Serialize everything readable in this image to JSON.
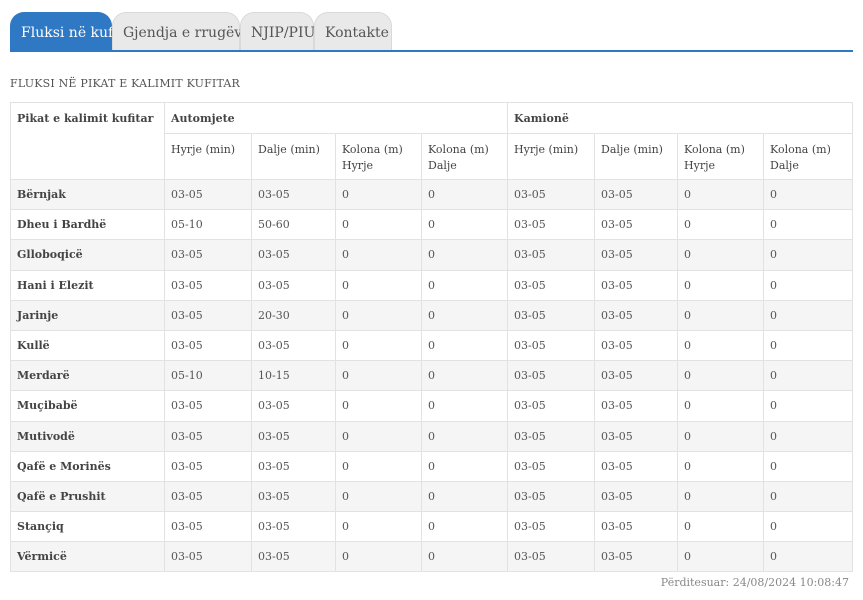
{
  "tabs": [
    {
      "label": "Fluksi në kufi",
      "active": true
    },
    {
      "label": "Gjendja e rrugëve",
      "active": false
    },
    {
      "label": "NJIP/PIU",
      "active": false
    },
    {
      "label": "Kontakte",
      "active": false
    }
  ],
  "section_title": "FLUKSI NË PIKAT E KALIMIT KUFITAR",
  "table": {
    "row_header": "Pikat e kalimit kufitar",
    "groups": [
      "Automjete",
      "Kamionë"
    ],
    "sub_headers": [
      "Hyrje (min)",
      "Dalje (min)",
      "Kolona (m) Hyrje",
      "Kolona (m) Dalje",
      "Hyrje (min)",
      "Dalje (min)",
      "Kolona (m) Hyrje",
      "Kolona (m) Dalje"
    ],
    "rows": [
      {
        "name": "Bërnjak",
        "values": [
          "03-05",
          "03-05",
          "0",
          "0",
          "03-05",
          "03-05",
          "0",
          "0"
        ]
      },
      {
        "name": "Dheu i Bardhë",
        "values": [
          "05-10",
          "50-60",
          "0",
          "0",
          "03-05",
          "03-05",
          "0",
          "0"
        ]
      },
      {
        "name": "Glloboqicë",
        "values": [
          "03-05",
          "03-05",
          "0",
          "0",
          "03-05",
          "03-05",
          "0",
          "0"
        ]
      },
      {
        "name": "Hani i Elezit",
        "values": [
          "03-05",
          "03-05",
          "0",
          "0",
          "03-05",
          "03-05",
          "0",
          "0"
        ]
      },
      {
        "name": "Jarinje",
        "values": [
          "03-05",
          "20-30",
          "0",
          "0",
          "03-05",
          "03-05",
          "0",
          "0"
        ]
      },
      {
        "name": "Kullë",
        "values": [
          "03-05",
          "03-05",
          "0",
          "0",
          "03-05",
          "03-05",
          "0",
          "0"
        ]
      },
      {
        "name": "Merdarë",
        "values": [
          "05-10",
          "10-15",
          "0",
          "0",
          "03-05",
          "03-05",
          "0",
          "0"
        ]
      },
      {
        "name": "Muçibabë",
        "values": [
          "03-05",
          "03-05",
          "0",
          "0",
          "03-05",
          "03-05",
          "0",
          "0"
        ]
      },
      {
        "name": "Mutivodë",
        "values": [
          "03-05",
          "03-05",
          "0",
          "0",
          "03-05",
          "03-05",
          "0",
          "0"
        ]
      },
      {
        "name": "Qafë e Morinës",
        "values": [
          "03-05",
          "03-05",
          "0",
          "0",
          "03-05",
          "03-05",
          "0",
          "0"
        ]
      },
      {
        "name": "Qafë e Prushit",
        "values": [
          "03-05",
          "03-05",
          "0",
          "0",
          "03-05",
          "03-05",
          "0",
          "0"
        ]
      },
      {
        "name": "Stançiq",
        "values": [
          "03-05",
          "03-05",
          "0",
          "0",
          "03-05",
          "03-05",
          "0",
          "0"
        ]
      },
      {
        "name": "Vërmicë",
        "values": [
          "03-05",
          "03-05",
          "0",
          "0",
          "03-05",
          "03-05",
          "0",
          "0"
        ]
      }
    ]
  },
  "updated": "Përditesuar: 24/08/2024 10:08:47",
  "colors": {
    "accent": "#2f78c4",
    "row_alt": "#f5f5f5",
    "border": "#e2e2e2"
  }
}
